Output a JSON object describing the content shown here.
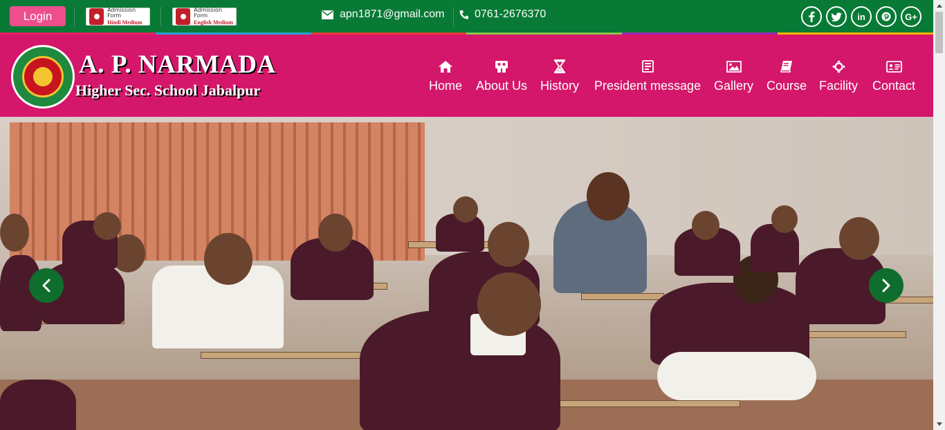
{
  "topbar": {
    "login_label": "Login",
    "admission_hindi": {
      "line1": "Admission Form",
      "line2": "Hindi Medium"
    },
    "admission_english": {
      "line1": "Admission Form",
      "line2": "English Medium"
    },
    "email": "apn1871@gmail.com",
    "phone": "0761-2676370",
    "social": [
      {
        "icon": "facebook-icon",
        "glyph": "f"
      },
      {
        "icon": "twitter-icon",
        "glyph": "t"
      },
      {
        "icon": "linkedin-icon",
        "glyph": "in"
      },
      {
        "icon": "pinterest-icon",
        "glyph": "p"
      },
      {
        "icon": "google-plus-icon",
        "glyph": "G+"
      }
    ],
    "stripe_colors": [
      "#e91e63",
      "#2a9fd8",
      "#e53935",
      "#8bc34a",
      "#9c27b0",
      "#ffb300"
    ]
  },
  "header": {
    "school_name": "A. P. NARMADA",
    "school_subtitle": "Higher Sec. School Jabalpur",
    "nav": [
      {
        "label": "Home",
        "icon": "home-icon"
      },
      {
        "label": "About Us",
        "icon": "people-icon"
      },
      {
        "label": "History",
        "icon": "hourglass-icon"
      },
      {
        "label": "President message",
        "icon": "message-icon"
      },
      {
        "label": "Gallery",
        "icon": "image-icon"
      },
      {
        "label": "Course",
        "icon": "book-icon"
      },
      {
        "label": "Facility",
        "icon": "cross-move-icon"
      },
      {
        "label": "Contact",
        "icon": "contact-card-icon"
      }
    ]
  },
  "colors": {
    "topbar_green": "#087a35",
    "header_pink": "#d4176a",
    "login_pink": "#ee4e8d",
    "arrow_green": "#0f6e2e"
  }
}
